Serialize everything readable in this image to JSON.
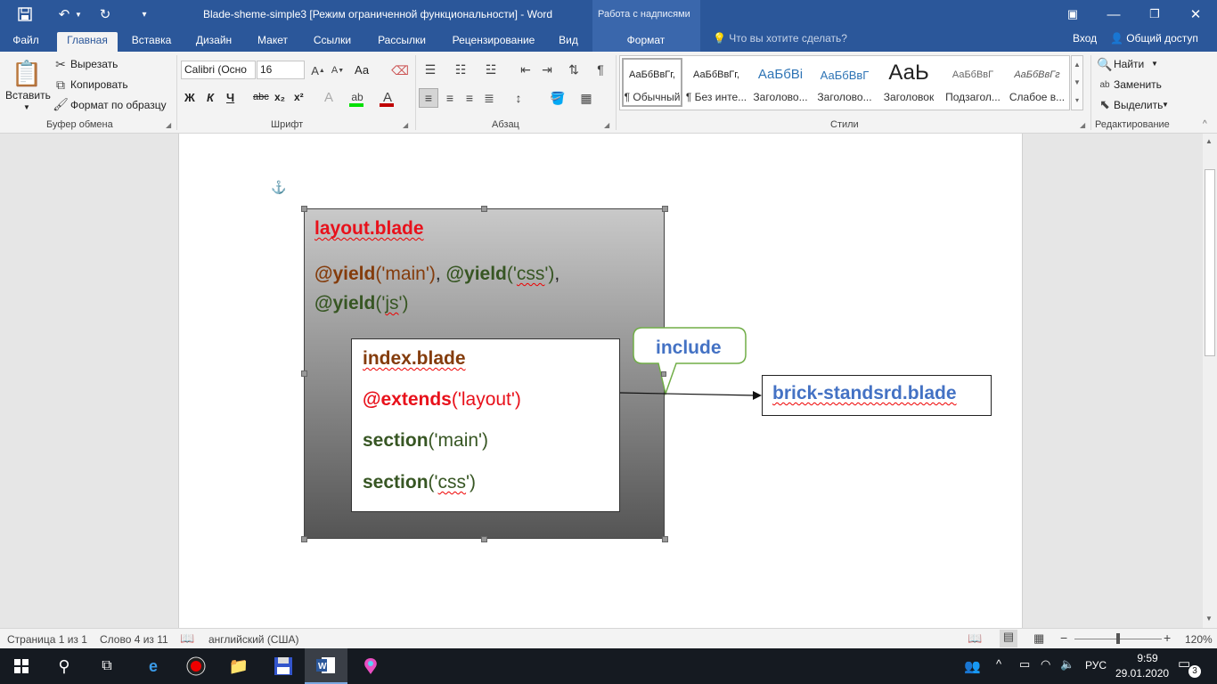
{
  "window": {
    "title": "Blade-sheme-simple3 [Режим ограниченной функциональности] - Word",
    "context_tab_title": "Работа с надписями"
  },
  "tabs": [
    "Файл",
    "Главная",
    "Вставка",
    "Дизайн",
    "Макет",
    "Ссылки",
    "Рассылки",
    "Рецензирование",
    "Вид",
    "Формат"
  ],
  "tellme_placeholder": "Что вы хотите сделать?",
  "account": {
    "login": "Вход",
    "share": "Общий доступ"
  },
  "ribbon": {
    "clipboard": {
      "paste": "Вставить",
      "cut": "Вырезать",
      "copy": "Копировать",
      "format_painter": "Формат по образцу",
      "label": "Буфер обмена"
    },
    "font": {
      "name": "Calibri (Осно",
      "size": "16",
      "label": "Шрифт",
      "change_case": "Аа",
      "bold": "Ж",
      "italic": "К",
      "underline": "Ч",
      "strike": "abc",
      "sub": "x₂",
      "sup": "x²"
    },
    "paragraph": {
      "label": "Абзац"
    },
    "styles": {
      "label": "Стили",
      "items": [
        {
          "sample": "АаБбВвГг,",
          "name": "¶ Обычный"
        },
        {
          "sample": "АаБбВвГг,",
          "name": "¶ Без инте..."
        },
        {
          "sample": "АаБбВі",
          "name": "Заголово..."
        },
        {
          "sample": "АаБбВвГ",
          "name": "Заголово..."
        },
        {
          "sample": "АаЬ",
          "name": "Заголовок"
        },
        {
          "sample": "АаБбВвГ",
          "name": "Подзагол..."
        },
        {
          "sample": "АаБбВвГг",
          "name": "Слабое в..."
        }
      ]
    },
    "editing": {
      "find": "Найти",
      "replace": "Заменить",
      "select": "Выделить",
      "label": "Редактирование"
    }
  },
  "document": {
    "outer": {
      "title": "layout.blade",
      "yield1_kw": "@yield",
      "yield1_arg": "('main')",
      "sep1": ", ",
      "yield2_kw": "@yield",
      "yield2_arg_a": "('",
      "yield2_arg_b": "css",
      "yield2_arg_c": "')",
      "sep2": ",",
      "yield3_kw": "@yield",
      "yield3_arg_a": "('",
      "yield3_arg_b": "js",
      "yield3_arg_c": "')"
    },
    "inner": {
      "title": "index.blade",
      "extends_kw": "@extends",
      "extends_arg": "('layout')",
      "section1_kw": "section",
      "section1_arg": "('main')",
      "section2_kw": "section",
      "section2_arg_a": "('",
      "section2_arg_b": "css",
      "section2_arg_c": "')"
    },
    "callout": "include",
    "target": "brick-standsrd.blade"
  },
  "statusbar": {
    "page": "Страница 1 из 1",
    "words": "Слово 4 из 11",
    "language": "английский (США)",
    "zoom": "120%"
  },
  "taskbar": {
    "lang": "РУС",
    "time": "9:59",
    "date": "29.01.2020",
    "notifications": "3"
  },
  "colors": {
    "word_blue": "#2b579a",
    "red": "#e8111b",
    "brown": "#843c0c",
    "dark_green": "#375623",
    "blue_text": "#4472c4",
    "callout_border": "#70ad47"
  }
}
